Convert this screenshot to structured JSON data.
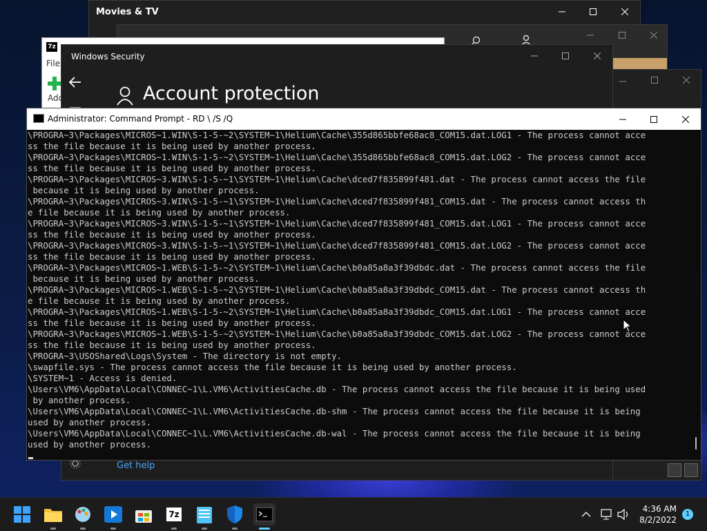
{
  "movies_tv": {
    "title": "Movies & TV"
  },
  "sevenzip": {
    "file_menu": "File",
    "add_label": "Add"
  },
  "security": {
    "title": "Windows Security",
    "heading": "Account protection",
    "get_help": "Get help"
  },
  "cmd": {
    "title": "Administrator: Command Prompt - RD  \\ /S /Q",
    "lines": [
      "\\PROGRA~3\\Packages\\MICROS~1.WIN\\S-1-5-~2\\SYSTEM~1\\Helium\\Cache\\355d865bbfe68ac8_COM15.dat.LOG1 - The process cannot acce",
      "ss the file because it is being used by another process.",
      "\\PROGRA~3\\Packages\\MICROS~1.WIN\\S-1-5-~2\\SYSTEM~1\\Helium\\Cache\\355d865bbfe68ac8_COM15.dat.LOG2 - The process cannot acce",
      "ss the file because it is being used by another process.",
      "\\PROGRA~3\\Packages\\MICROS~3.WIN\\S-1-5-~1\\SYSTEM~1\\Helium\\Cache\\dced7f835899f481.dat - The process cannot access the file",
      " because it is being used by another process.",
      "\\PROGRA~3\\Packages\\MICROS~3.WIN\\S-1-5-~1\\SYSTEM~1\\Helium\\Cache\\dced7f835899f481_COM15.dat - The process cannot access th",
      "e file because it is being used by another process.",
      "\\PROGRA~3\\Packages\\MICROS~3.WIN\\S-1-5-~1\\SYSTEM~1\\Helium\\Cache\\dced7f835899f481_COM15.dat.LOG1 - The process cannot acce",
      "ss the file because it is being used by another process.",
      "\\PROGRA~3\\Packages\\MICROS~3.WIN\\S-1-5-~1\\SYSTEM~1\\Helium\\Cache\\dced7f835899f481_COM15.dat.LOG2 - The process cannot acce",
      "ss the file because it is being used by another process.",
      "\\PROGRA~3\\Packages\\MICROS~1.WEB\\S-1-5-~2\\SYSTEM~1\\Helium\\Cache\\b0a85a8a3f39dbdc.dat - The process cannot access the file",
      " because it is being used by another process.",
      "\\PROGRA~3\\Packages\\MICROS~1.WEB\\S-1-5-~2\\SYSTEM~1\\Helium\\Cache\\b0a85a8a3f39dbdc_COM15.dat - The process cannot access th",
      "e file because it is being used by another process.",
      "\\PROGRA~3\\Packages\\MICROS~1.WEB\\S-1-5-~2\\SYSTEM~1\\Helium\\Cache\\b0a85a8a3f39dbdc_COM15.dat.LOG1 - The process cannot acce",
      "ss the file because it is being used by another process.",
      "\\PROGRA~3\\Packages\\MICROS~1.WEB\\S-1-5-~2\\SYSTEM~1\\Helium\\Cache\\b0a85a8a3f39dbdc_COM15.dat.LOG2 - The process cannot acce",
      "ss the file because it is being used by another process.",
      "\\PROGRA~3\\USOShared\\Logs\\System - The directory is not empty.",
      "\\swapfile.sys - The process cannot access the file because it is being used by another process.",
      "\\SYSTEM~1 - Access is denied.",
      "\\Users\\VM6\\AppData\\Local\\CONNEC~1\\L.VM6\\ActivitiesCache.db - The process cannot access the file because it is being used",
      " by another process.",
      "\\Users\\VM6\\AppData\\Local\\CONNEC~1\\L.VM6\\ActivitiesCache.db-shm - The process cannot access the file because it is being",
      "used by another process.",
      "\\Users\\VM6\\AppData\\Local\\CONNEC~1\\L.VM6\\ActivitiesCache.db-wal - The process cannot access the file because it is being",
      "used by another process."
    ]
  },
  "taskbar": {
    "apps": [
      "start-button",
      "file-explorer",
      "paint",
      "media-player",
      "store",
      "7zip",
      "notepad",
      "windows-security",
      "command-prompt"
    ],
    "sevenzip_label": "7z",
    "time": "4:36 AM",
    "date": "8/2/2022",
    "notification_count": "1"
  },
  "colors": {
    "accent": "#60cdff",
    "console_bg": "#0c0c0c",
    "console_fg": "#cccccc",
    "link": "#4aa3ff"
  }
}
